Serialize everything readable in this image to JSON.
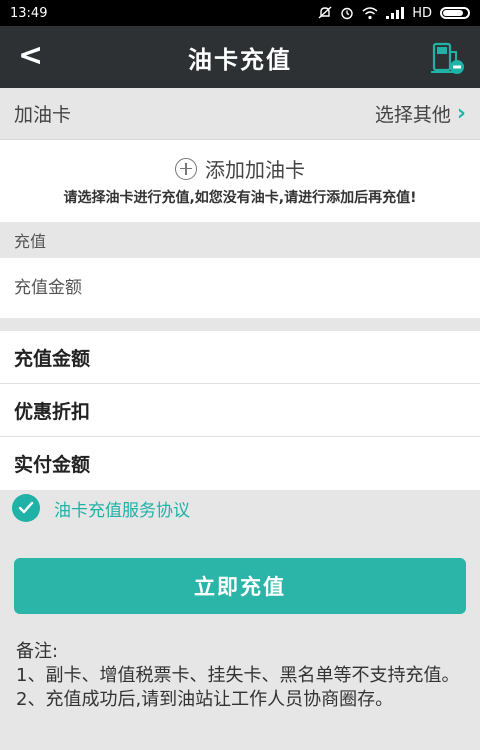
{
  "status_bar": {
    "time": "13:49",
    "network": "HD"
  },
  "header": {
    "back": "<",
    "title": "油卡充值"
  },
  "fuel_card": {
    "label": "加油卡",
    "select_other": "选择其他",
    "chevron": "›"
  },
  "add_card": {
    "label": "添加加油卡",
    "hint": "请选择油卡进行充值,如您没有油卡,请进行添加后再充值!"
  },
  "recharge": {
    "section_label": "充值",
    "amount_placeholder": "充值金额"
  },
  "summary": {
    "rows": [
      "充值金额",
      "优惠折扣",
      "实付金额"
    ]
  },
  "agreement": {
    "text": "油卡充值服务协议"
  },
  "submit": {
    "label": "立即充值"
  },
  "notes": {
    "title": "备注:",
    "line1": "1、副卡、增值税票卡、挂失卡、黑名单等不支持充值。",
    "line2": "2、充值成功后,请到油站让工作人员协商圈存。"
  },
  "colors": {
    "accent": "#20b1a7",
    "title_bar": "#2d3134"
  },
  "icons": [
    "back-icon",
    "gas-station-icon",
    "plus-circle-icon",
    "chevron-right-icon",
    "check-icon",
    "battery-icon",
    "wifi-icon",
    "signal-icon",
    "alarm-icon",
    "mute-icon"
  ]
}
